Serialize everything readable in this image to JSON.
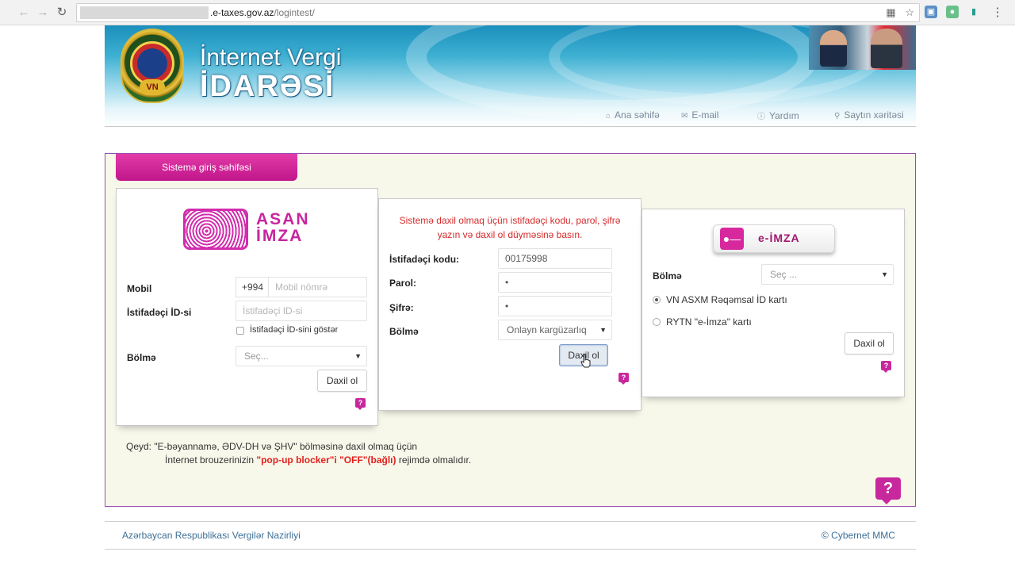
{
  "browser": {
    "url_host": ".e-taxes.gov.az",
    "url_path": "/logintest/"
  },
  "banner": {
    "title_line1": "İnternet Vergi",
    "title_line2": "İDARƏSİ",
    "emblem_text": "VN"
  },
  "top_links": {
    "home": "Ana səhifə",
    "email": "E-mail",
    "help": "Yardım",
    "sitemap": "Saytın xəritəsi"
  },
  "tab_label": "Sistemə giriş səhifəsi",
  "asan": {
    "logo_text_1": "ASAN",
    "logo_text_2": "İMZA",
    "mobile_label": "Mobil",
    "prefix": "+994",
    "mobile_placeholder": "Mobil nömrə",
    "id_label": "İstifadəçi İD-si",
    "id_placeholder": "İstifadəçi ID-si",
    "show_id_label": "İstifadəçi İD-sini göstər",
    "section_label": "Bölmə",
    "section_value": "Seç...",
    "login_button": "Daxil ol"
  },
  "standard": {
    "message": "Sistemə daxil olmaq üçün istifadəçi kodu, parol, şifrə yazın və daxil ol düyməsinə basın.",
    "user_code_label": "İstifadəçi kodu:",
    "user_code_value": "00175998",
    "password_label": "Parol:",
    "password_value": "•",
    "cipher_label": "Şifrə:",
    "cipher_value": "•",
    "section_label": "Bölmə",
    "section_value": "Onlayn kargüzarlıq",
    "login_button": "Daxil ol"
  },
  "eimza": {
    "logo_text": "e-İMZA",
    "section_label": "Bölmə",
    "section_value": "Seç ...",
    "radio_1": "VN ASXM Rəqəmsal İD kartı",
    "radio_2": "RYTN \"e-İmza\" kartı",
    "login_button": "Daxil ol"
  },
  "note": {
    "line1": "Qeyd: \"E-bəyannamə, ƏDV-DH və ŞHV\" bölməsinə daxil olmaq üçün",
    "line2_pre": "İnternet brouzerinizin",
    "line2_bold": "\"pop-up blocker\"i \"OFF\"(bağlı)",
    "line2_post": "rejimdə olmalıdır."
  },
  "footer": {
    "left": "Azərbaycan Respublikası Vergilər Nazirliyi",
    "right": "© Cybernet MMC"
  },
  "colors": {
    "accent": "#c8289e",
    "frame_border": "#9a4ab0",
    "link": "#3d6f96",
    "warning": "#d62a2a"
  }
}
